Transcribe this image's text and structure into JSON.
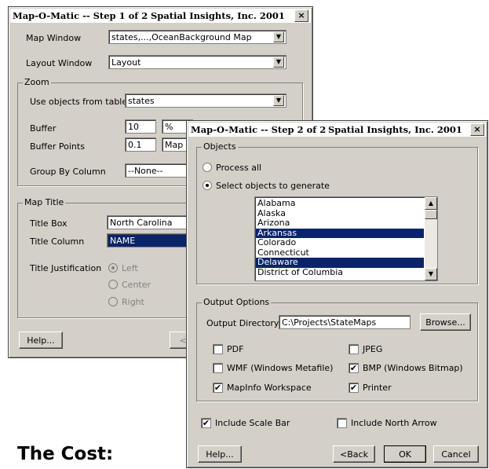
{
  "dialog1": {
    "title": "Map-O-Matic -- Step 1 of 2",
    "company": "Spatial Insights, Inc. 2001",
    "close_glyph": "×",
    "map_window_label": "Map Window",
    "map_window_value": "states,...,OceanBackground Map",
    "layout_window_label": "Layout Window",
    "layout_window_value": "Layout",
    "zoom_group": "Zoom",
    "use_objects_label": "Use objects from table",
    "use_objects_value": "states",
    "buffer_label": "Buffer",
    "buffer_value": "10",
    "buffer_unit": "%",
    "buffer_points_label": "Buffer Points",
    "buffer_points_value": "0.1",
    "buffer_points_unit": "Map U",
    "group_by_label": "Group By Column",
    "group_by_value": "--None--",
    "map_title_group": "Map Title",
    "title_box_label": "Title Box",
    "title_box_value": "North Carolina",
    "title_column_label": "Title Column",
    "title_column_value": "NAME",
    "title_justification_label": "Title Justification",
    "justify_left": "Left",
    "justify_center": "Center",
    "justify_right": "Right",
    "help_button": "Help...",
    "back_button": "<Ba"
  },
  "dialog2": {
    "title": "Map-O-Matic -- Step 2 of 2",
    "company": "Spatial Insights, Inc. 2001",
    "close_glyph": "×",
    "objects_group": "Objects",
    "process_all": "Process all",
    "select_objects": "Select objects to generate",
    "states": [
      {
        "name": "Alabama",
        "selected": false
      },
      {
        "name": "Alaska",
        "selected": false
      },
      {
        "name": "Arizona",
        "selected": false
      },
      {
        "name": "Arkansas",
        "selected": true
      },
      {
        "name": "Colorado",
        "selected": false
      },
      {
        "name": "Connecticut",
        "selected": false
      },
      {
        "name": "Delaware",
        "selected": true
      },
      {
        "name": "District of Columbia",
        "selected": false
      }
    ],
    "output_group": "Output Options",
    "output_dir_label": "Output Directory",
    "output_dir_value": "C:\\Projects\\StateMaps",
    "browse_button": "Browse...",
    "pdf": {
      "label": "PDF",
      "checked": false
    },
    "jpeg": {
      "label": "JPEG",
      "checked": false
    },
    "wmf": {
      "label": "WMF (Windows Metafile)",
      "checked": false
    },
    "bmp": {
      "label": "BMP (Windows Bitmap)",
      "checked": true
    },
    "workspace": {
      "label": "MapInfo Workspace",
      "checked": true
    },
    "printer": {
      "label": "Printer",
      "checked": true
    },
    "scale_bar": {
      "label": "Include Scale Bar",
      "checked": true
    },
    "north_arrow": {
      "label": "Include North Arrow",
      "checked": false
    },
    "help_button": "Help...",
    "back_button": "<Back",
    "ok_button": "OK",
    "cancel_button": "Cancel"
  },
  "caption": "The Cost:"
}
